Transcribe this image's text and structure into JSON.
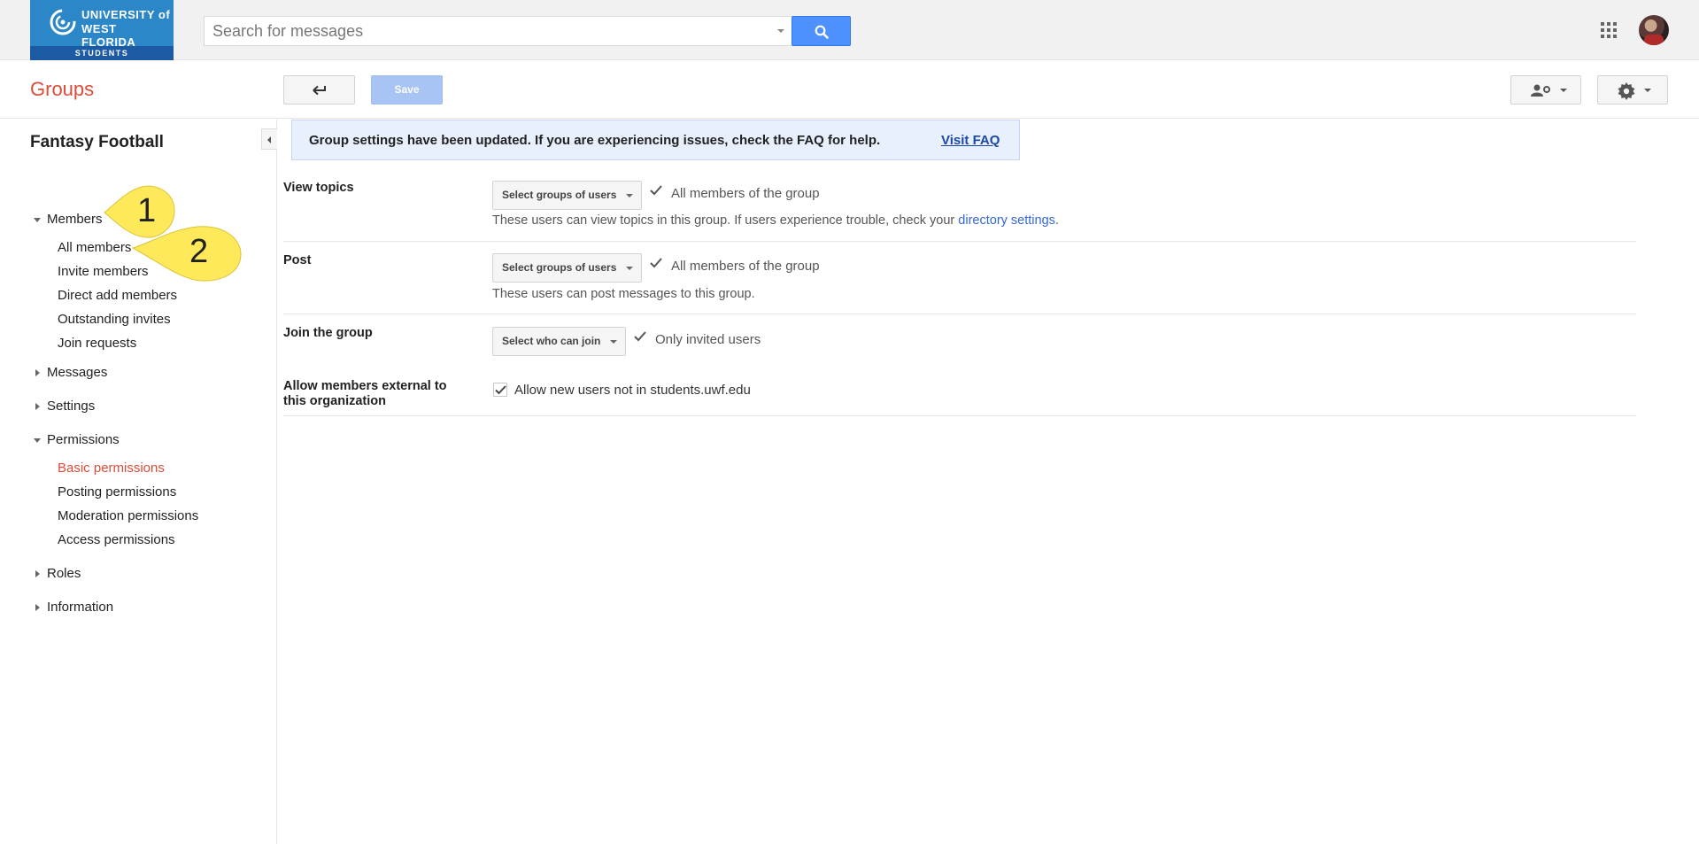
{
  "topbar": {
    "logo": {
      "line1": "UNIVERSITY of",
      "line2": "WEST FLORIDA",
      "bottom": "STUDENTS"
    },
    "search": {
      "placeholder": "Search for messages"
    }
  },
  "header": {
    "title": "Groups",
    "save_label": "Save"
  },
  "sidebar": {
    "group_name": "Fantasy Football",
    "sections": {
      "members": "Members",
      "members_items": [
        "All members",
        "Invite members",
        "Direct add members",
        "Outstanding invites",
        "Join requests"
      ],
      "messages": "Messages",
      "settings": "Settings",
      "permissions": "Permissions",
      "permissions_items": [
        "Basic permissions",
        "Posting permissions",
        "Moderation permissions",
        "Access permissions"
      ],
      "roles": "Roles",
      "information": "Information"
    },
    "annotations": [
      "1",
      "2"
    ]
  },
  "banner": {
    "text": "Group settings have been updated. If you are experiencing issues, check the FAQ for help.",
    "link": "Visit FAQ"
  },
  "settings": {
    "view_topics": {
      "label": "View topics",
      "button": "Select groups of users",
      "value": "All members of the group",
      "desc": "These users can view topics in this group. If users experience trouble, check your ",
      "desc_link": "directory settings",
      "desc_end": "."
    },
    "post": {
      "label": "Post",
      "button": "Select groups of users",
      "value": "All members of the group",
      "desc": "These users can post messages to this group."
    },
    "join": {
      "label": "Join the group",
      "button": "Select who can join",
      "value": "Only invited users"
    },
    "external": {
      "label_line1": "Allow members external to",
      "label_line2": "this organization",
      "checkbox_label": "Allow new users not in students.uwf.edu",
      "checked": true
    }
  },
  "colors": {
    "accent_red": "#dd4b39",
    "search_blue": "#4d90fe",
    "link_blue": "#3367d6",
    "annotation_yellow": "#fde95a"
  }
}
